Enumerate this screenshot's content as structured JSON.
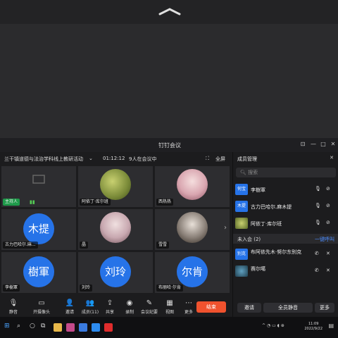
{
  "window": {
    "title": "钉钉会议"
  },
  "meeting": {
    "name": "兰干镇道德与法治学科线上教研活动",
    "elapsed": "01:12:12",
    "attendance": "9人在会议中",
    "fullscreen_label": "全屏"
  },
  "tiles": [
    {
      "label": "",
      "tag": "主持人"
    },
    {
      "label": "",
      "tag": "阿依丁·库尔班"
    },
    {
      "label": "",
      "tag": "西热热"
    },
    {
      "label": "木提",
      "tag": "古力巴哈尔.麻..."
    },
    {
      "label": "",
      "tag": "晶"
    },
    {
      "label": "",
      "tag": "雪雪"
    },
    {
      "label": "樹軍",
      "tag": "李樹軍"
    },
    {
      "label": "刘玲",
      "tag": "刘玲"
    },
    {
      "label": "尔肯",
      "tag": "布丽哈·尔肯"
    }
  ],
  "toolbar": {
    "mute": "静音",
    "camera": "开摄像头",
    "invite": "邀请",
    "members": "成员(11)",
    "share": "共享",
    "record": "录制",
    "minutes": "会议纪要",
    "view": "视图",
    "more": "更多",
    "end": "结束"
  },
  "panel": {
    "title": "成员管理",
    "search_placeholder": "搜索",
    "members": [
      {
        "avatar": "何宝",
        "name": "李樹軍"
      },
      {
        "avatar": "木提",
        "name": "古力巴哈尔.麻木提"
      },
      {
        "avatar": "",
        "name": "阿依丁·库尔班"
      }
    ],
    "not_joined_label": "未入会 (2)",
    "call_all": "一键呼叫",
    "pending": [
      {
        "avatar": "别克",
        "name": "布阿依先木·努尔东别克",
        "sub": ""
      },
      {
        "avatar": "",
        "name": "赛尔噶",
        "sub": ""
      }
    ],
    "invite_btn": "邀请",
    "mute_all_btn": "全员静音",
    "more_btn": "更多"
  },
  "taskbar": {
    "time": "11:09",
    "date": "2022/9/22"
  },
  "colors": {
    "accent": "#2673e8",
    "end": "#f0522e"
  }
}
